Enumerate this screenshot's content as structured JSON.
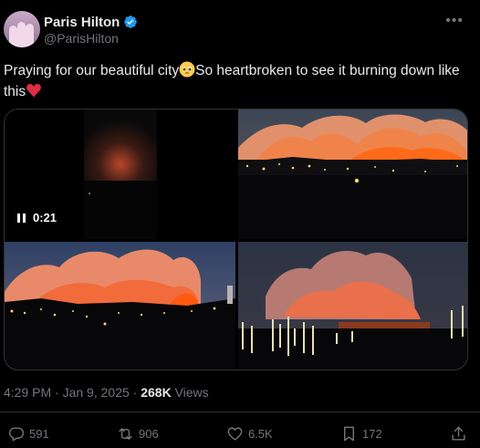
{
  "author": {
    "display_name": "Paris Hilton",
    "handle": "@ParisHilton",
    "verified": true
  },
  "more_icon": "more-horizontal-icon",
  "text": {
    "part1": "Praying for our beautiful city",
    "emoji1": "pleading-face-emoji",
    "part2": "So heartbroken to see it burning down like this",
    "emoji2": "broken-heart-emoji"
  },
  "media": {
    "video_time": "0:21",
    "items": [
      {
        "type": "video",
        "description_icon": "video-thumbnail"
      },
      {
        "type": "image"
      },
      {
        "type": "image"
      },
      {
        "type": "image"
      }
    ]
  },
  "meta": {
    "time": "4:29 PM",
    "date": "Jan 9, 2025",
    "views_count": "268K",
    "views_label": "Views"
  },
  "actions": {
    "replies": "591",
    "reposts": "906",
    "likes": "6.5K",
    "bookmarks": "172"
  },
  "colors": {
    "background": "#000000",
    "text": "#e7e9ea",
    "secondary": "#71767b",
    "border": "#2f3336",
    "verified": "#1d9bf0"
  }
}
